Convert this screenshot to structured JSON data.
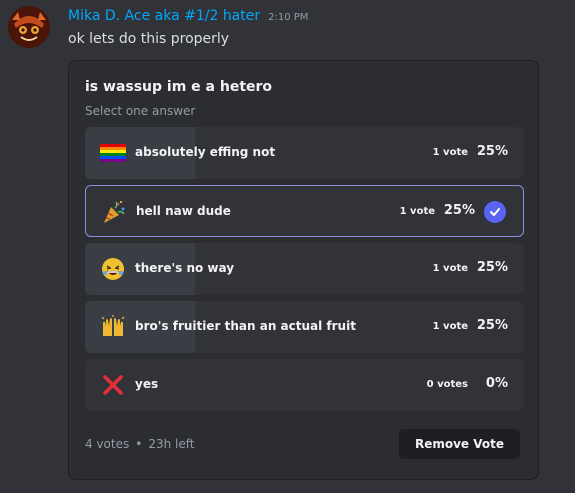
{
  "message": {
    "username": "Mika D. Ace aka #1/2 hater",
    "timestamp": "2:10 PM",
    "content": "ok lets do this properly"
  },
  "poll": {
    "question": "is wassup im e a hetero",
    "prompt": "Select one answer",
    "answers": [
      {
        "emoji": "rainbow-flag-icon",
        "label": "absolutely effing not",
        "votes": "1 vote",
        "percent": "25%",
        "fraction": 0.25,
        "selected": false
      },
      {
        "emoji": "party-popper-icon",
        "label": "hell naw dude",
        "votes": "1 vote",
        "percent": "25%",
        "fraction": 0.25,
        "selected": true
      },
      {
        "emoji": "laughing-face-icon",
        "label": "there's no way",
        "votes": "1 vote",
        "percent": "25%",
        "fraction": 0.25,
        "selected": false
      },
      {
        "emoji": "raised-hands-icon",
        "label": "bro's fruitier than an actual fruit",
        "votes": "1 vote",
        "percent": "25%",
        "fraction": 0.25,
        "selected": false
      },
      {
        "emoji": "cross-mark-icon",
        "label": "yes",
        "votes": "0 votes",
        "percent": "0%",
        "fraction": 0,
        "selected": false
      }
    ],
    "total_votes": "4 votes",
    "time_left": "23h left",
    "remove_label": "Remove Vote"
  },
  "colors": {
    "username": "#00a8fc",
    "accent": "#5865f2",
    "selected_border": "#8b8fe0"
  }
}
